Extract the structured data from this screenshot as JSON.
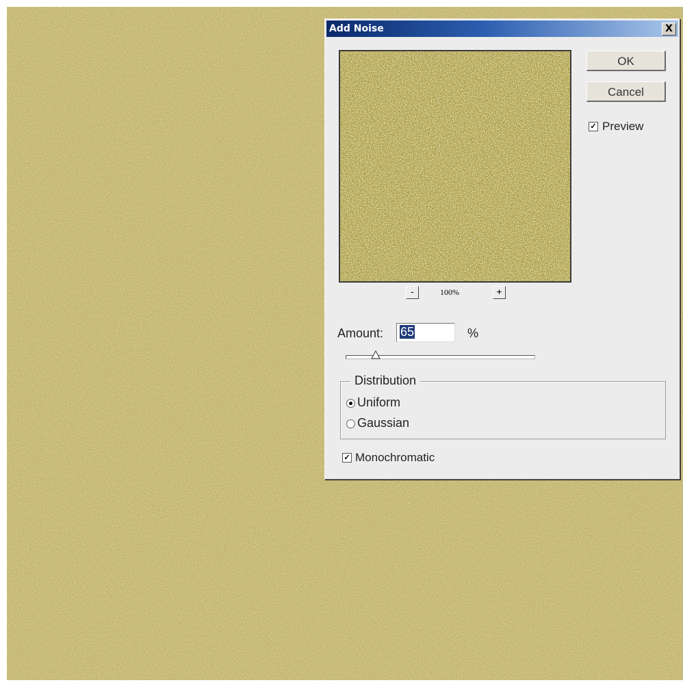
{
  "dialog": {
    "title": "Add Noise",
    "close_glyph": "X",
    "ok_label": "OK",
    "cancel_label": "Cancel",
    "preview_checkbox": {
      "label": "Preview",
      "checked": true
    },
    "zoom": {
      "minus_glyph": "-",
      "plus_glyph": "+",
      "level": "100%"
    },
    "amount": {
      "label": "Amount:",
      "value": "65",
      "unit": "%",
      "slider_fraction": 0.16
    },
    "distribution": {
      "legend": "Distribution",
      "options": [
        {
          "label": "Uniform",
          "selected": true
        },
        {
          "label": "Gaussian",
          "selected": false
        }
      ]
    },
    "monochromatic": {
      "label": "Monochromatic",
      "checked": true
    }
  },
  "icons": {
    "close": "close-icon",
    "checkbox_check": "checkmark-icon",
    "slider_thumb": "triangle-thumb-icon"
  },
  "colors": {
    "canvas_base": "#c2b46c",
    "preview_base": "#b4a64e",
    "title_gradient_start": "#0a2a6b",
    "title_gradient_end": "#a9c6ea",
    "selection": "#1f3a7a"
  }
}
